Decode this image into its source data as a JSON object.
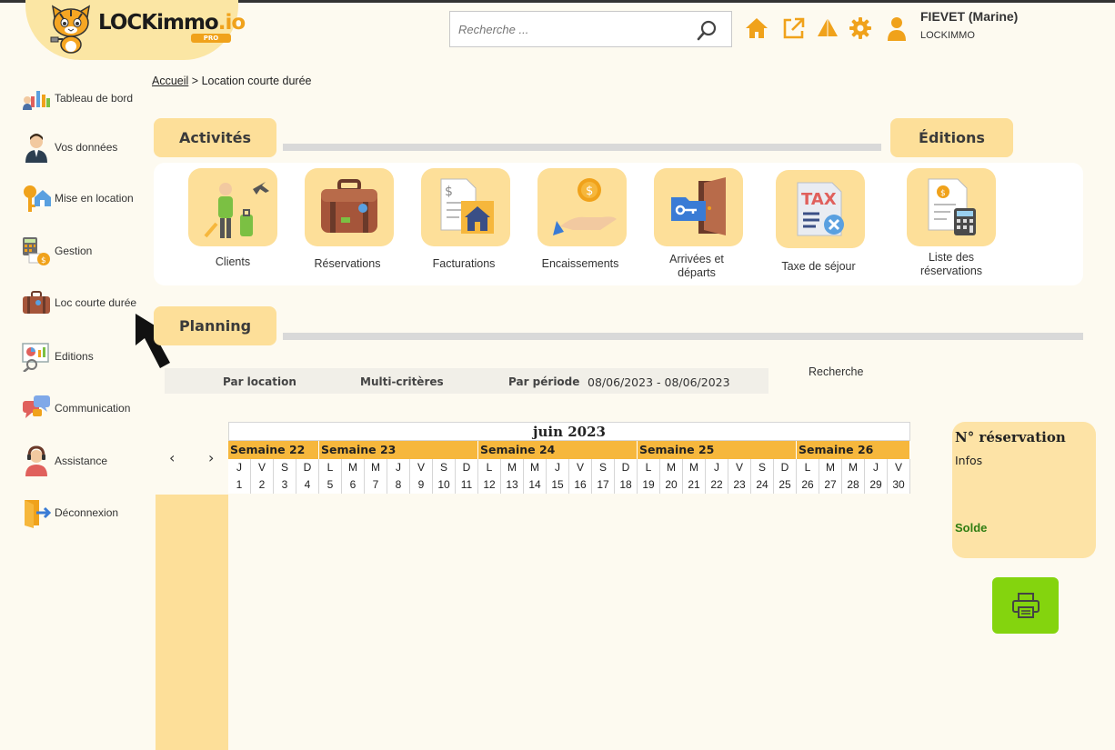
{
  "header": {
    "logo_text": "LOCKimmo",
    "logo_suffix": ".io",
    "logo_badge": "PRO",
    "search_placeholder": "Recherche ...",
    "user_name": "FIEVET (Marine)",
    "company": "LOCKIMMO"
  },
  "sidebar": {
    "items": [
      {
        "label": "Tableau de bord",
        "icon": "dashboard-icon"
      },
      {
        "label": "Vos données",
        "icon": "user-icon"
      },
      {
        "label": "Mise en location",
        "icon": "key-house-icon"
      },
      {
        "label": "Gestion",
        "icon": "calculator-icon"
      },
      {
        "label": "Loc courte durée",
        "icon": "suitcase-icon"
      },
      {
        "label": "Editions",
        "icon": "report-icon"
      },
      {
        "label": "Communication",
        "icon": "chat-icon"
      },
      {
        "label": "Assistance",
        "icon": "support-icon"
      },
      {
        "label": "Déconnexion",
        "icon": "logout-icon"
      }
    ]
  },
  "breadcrumb": {
    "home": "Accueil",
    "separator": ">",
    "current": "Location courte durée"
  },
  "sections": {
    "activites": "Activités",
    "editions": "Éditions",
    "planning": "Planning"
  },
  "activities": [
    {
      "label": "Clients"
    },
    {
      "label": "Réservations"
    },
    {
      "label": "Facturations"
    },
    {
      "label": "Encaissements"
    },
    {
      "label": "Arrivées et départs"
    },
    {
      "label": "Taxe de séjour"
    },
    {
      "label": "Liste des réservations"
    }
  ],
  "filters": {
    "par_location": "Par location",
    "multi_criteres": "Multi-critères",
    "par_periode": "Par période",
    "date_range": "08/06/2023 - 08/06/2023",
    "recherche": "Recherche"
  },
  "calendar": {
    "month": "juin 2023",
    "nav_prev": "‹",
    "nav_next": "›",
    "weeks": [
      {
        "label": "Semaine 22",
        "days": 4
      },
      {
        "label": "Semaine 23",
        "days": 7
      },
      {
        "label": "Semaine 24",
        "days": 7
      },
      {
        "label": "Semaine 25",
        "days": 7
      },
      {
        "label": "Semaine 26",
        "days": 5
      }
    ],
    "weekdays": [
      "J",
      "V",
      "S",
      "D",
      "L",
      "M",
      "M",
      "J",
      "V",
      "S",
      "D",
      "L",
      "M",
      "M",
      "J",
      "V",
      "S",
      "D",
      "L",
      "M",
      "M",
      "J",
      "V",
      "S",
      "D",
      "L",
      "M",
      "M",
      "J",
      "V"
    ],
    "days": [
      "1",
      "2",
      "3",
      "4",
      "5",
      "6",
      "7",
      "8",
      "9",
      "10",
      "11",
      "12",
      "13",
      "14",
      "15",
      "16",
      "17",
      "18",
      "19",
      "20",
      "21",
      "22",
      "23",
      "24",
      "25",
      "26",
      "27",
      "28",
      "29",
      "30"
    ]
  },
  "reservation": {
    "title": "N° réservation",
    "infos": "Infos",
    "solde": "Solde"
  },
  "colors": {
    "accent": "#fddf99",
    "week_header": "#f6b73c",
    "print_button": "#84d40e",
    "icon_orange": "#f0a21b"
  }
}
